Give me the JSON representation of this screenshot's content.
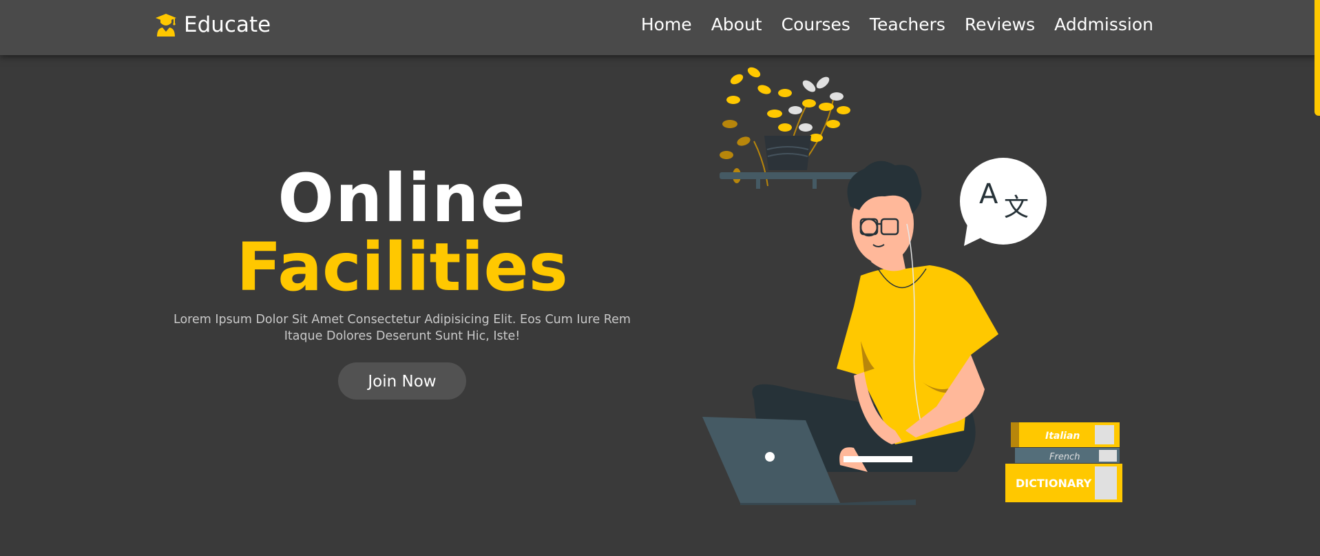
{
  "brand": {
    "name": "Educate",
    "icon": "graduate-icon"
  },
  "nav": {
    "items": [
      {
        "label": "Home"
      },
      {
        "label": "About"
      },
      {
        "label": "Courses"
      },
      {
        "label": "Teachers"
      },
      {
        "label": "Reviews"
      },
      {
        "label": "Addmission"
      }
    ]
  },
  "hero": {
    "title_line1": "Online",
    "title_line2": "Facilities",
    "description": "Lorem Ipsum Dolor Sit Amet Consectetur Adipisicing Elit. Eos Cum Iure Rem Itaque Dolores Deserunt Sunt Hic, Iste!",
    "cta_label": "Join Now"
  },
  "illustration": {
    "translate_bubble_text_a": "A",
    "translate_bubble_text_b": "文",
    "books": [
      {
        "label": "Italian"
      },
      {
        "label": "French"
      },
      {
        "label": "DICTIONARY"
      }
    ]
  },
  "colors": {
    "background": "#3a3a3a",
    "navbar": "#4a4a4a",
    "accent": "#ffc800",
    "button": "#525252"
  }
}
